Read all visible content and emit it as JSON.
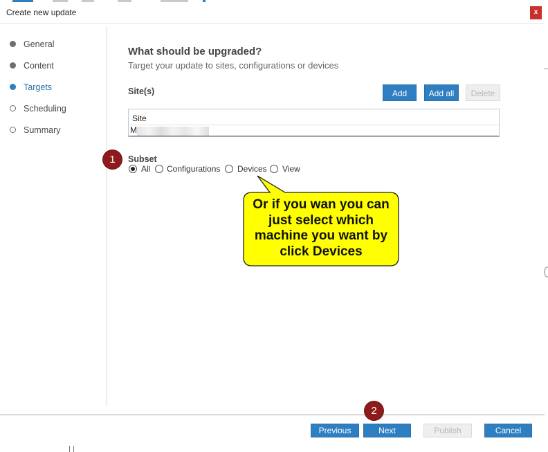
{
  "dialog": {
    "title": "Create new update",
    "close_label": "x"
  },
  "steps": [
    {
      "label": "General",
      "state": "done"
    },
    {
      "label": "Content",
      "state": "done"
    },
    {
      "label": "Targets",
      "state": "active"
    },
    {
      "label": "Scheduling",
      "state": "todo"
    },
    {
      "label": "Summary",
      "state": "todo"
    }
  ],
  "main": {
    "heading": "What should be upgraded?",
    "subheading": "Target your update to sites, configurations or devices",
    "sites_label": "Site(s)",
    "buttons": {
      "add": "Add",
      "add_all": "Add all",
      "delete": "Delete"
    },
    "table": {
      "header": "Site",
      "rows": [
        {
          "value": "M"
        }
      ]
    },
    "subset": {
      "label": "Subset",
      "options": [
        {
          "label": "All",
          "selected": true
        },
        {
          "label": "Configurations",
          "selected": false
        },
        {
          "label": "Devices",
          "selected": false
        },
        {
          "label": "View",
          "selected": false
        }
      ]
    }
  },
  "annotations": {
    "badge1": "1",
    "badge2": "2",
    "callout": "Or if you wan you can just select which machine you want by click Devices",
    "callout_color": "#ffff00",
    "badge_color": "#8e1b1b"
  },
  "footer": {
    "previous": "Previous",
    "next": "Next",
    "publish": "Publish",
    "cancel": "Cancel"
  },
  "colors": {
    "accent": "#2d7fc1",
    "close": "#c9302c"
  }
}
